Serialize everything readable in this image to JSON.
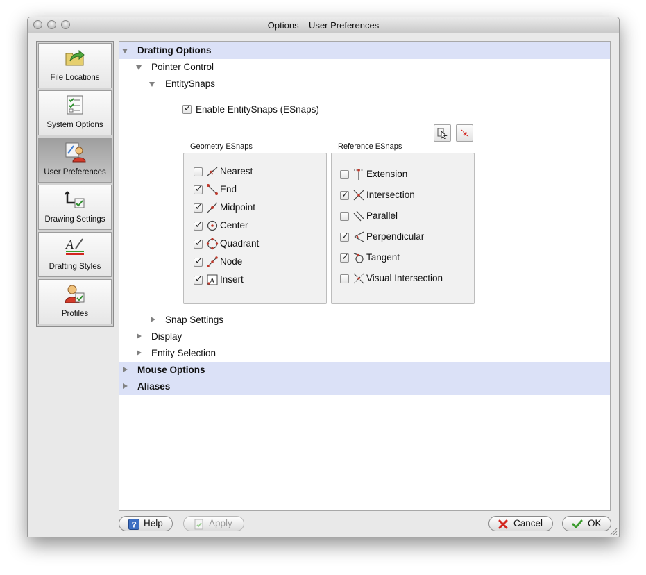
{
  "window": {
    "title": "Options – User Preferences"
  },
  "sidebar": {
    "items": [
      {
        "label": "File Locations",
        "icon": "folder-arrow-icon",
        "selected": false
      },
      {
        "label": "System Options",
        "icon": "checklist-icon",
        "selected": false
      },
      {
        "label": "User Preferences",
        "icon": "user-pencil-icon",
        "selected": true
      },
      {
        "label": "Drawing Settings",
        "icon": "drawing-settings-icon",
        "selected": false
      },
      {
        "label": "Drafting Styles",
        "icon": "text-style-icon",
        "selected": false
      },
      {
        "label": "Profiles",
        "icon": "profile-user-icon",
        "selected": false
      }
    ]
  },
  "tree": {
    "drafting_options": "Drafting Options",
    "pointer_control": "Pointer Control",
    "entity_snaps": "EntitySnaps",
    "enable_esnaps": {
      "label": "Enable EntitySnaps (ESnaps)",
      "checked": true
    },
    "snap_settings": "Snap Settings",
    "display": "Display",
    "entity_selection": "Entity Selection",
    "mouse_options": "Mouse Options",
    "aliases": "Aliases"
  },
  "geometry_esnaps": {
    "title": "Geometry ESnaps",
    "items": [
      {
        "label": "Nearest",
        "checked": false,
        "icon": "nearest-snap-icon"
      },
      {
        "label": "End",
        "checked": true,
        "icon": "end-snap-icon"
      },
      {
        "label": "Midpoint",
        "checked": true,
        "icon": "midpoint-snap-icon"
      },
      {
        "label": "Center",
        "checked": true,
        "icon": "center-snap-icon"
      },
      {
        "label": "Quadrant",
        "checked": true,
        "icon": "quadrant-snap-icon"
      },
      {
        "label": "Node",
        "checked": true,
        "icon": "node-snap-icon"
      },
      {
        "label": "Insert",
        "checked": true,
        "icon": "insert-snap-icon"
      }
    ]
  },
  "reference_esnaps": {
    "title": "Reference ESnaps",
    "items": [
      {
        "label": "Extension",
        "checked": false,
        "icon": "extension-snap-icon"
      },
      {
        "label": "Intersection",
        "checked": true,
        "icon": "intersection-snap-icon"
      },
      {
        "label": "Parallel",
        "checked": false,
        "icon": "parallel-snap-icon"
      },
      {
        "label": "Perpendicular",
        "checked": true,
        "icon": "perpendicular-snap-icon"
      },
      {
        "label": "Tangent",
        "checked": true,
        "icon": "tangent-snap-icon"
      },
      {
        "label": "Visual Intersection",
        "checked": false,
        "icon": "visual-intersection-snap-icon"
      }
    ]
  },
  "toolbar": {
    "select_all_icon": "select-all-snaps-icon",
    "clear_all_icon": "clear-all-snaps-icon"
  },
  "buttons": {
    "help": "Help",
    "apply": "Apply",
    "cancel": "Cancel",
    "ok": "OK"
  },
  "colors": {
    "section_highlight": "#dbe1f7",
    "ok_check": "#3a9a2c",
    "cancel_x": "#d3261f"
  }
}
